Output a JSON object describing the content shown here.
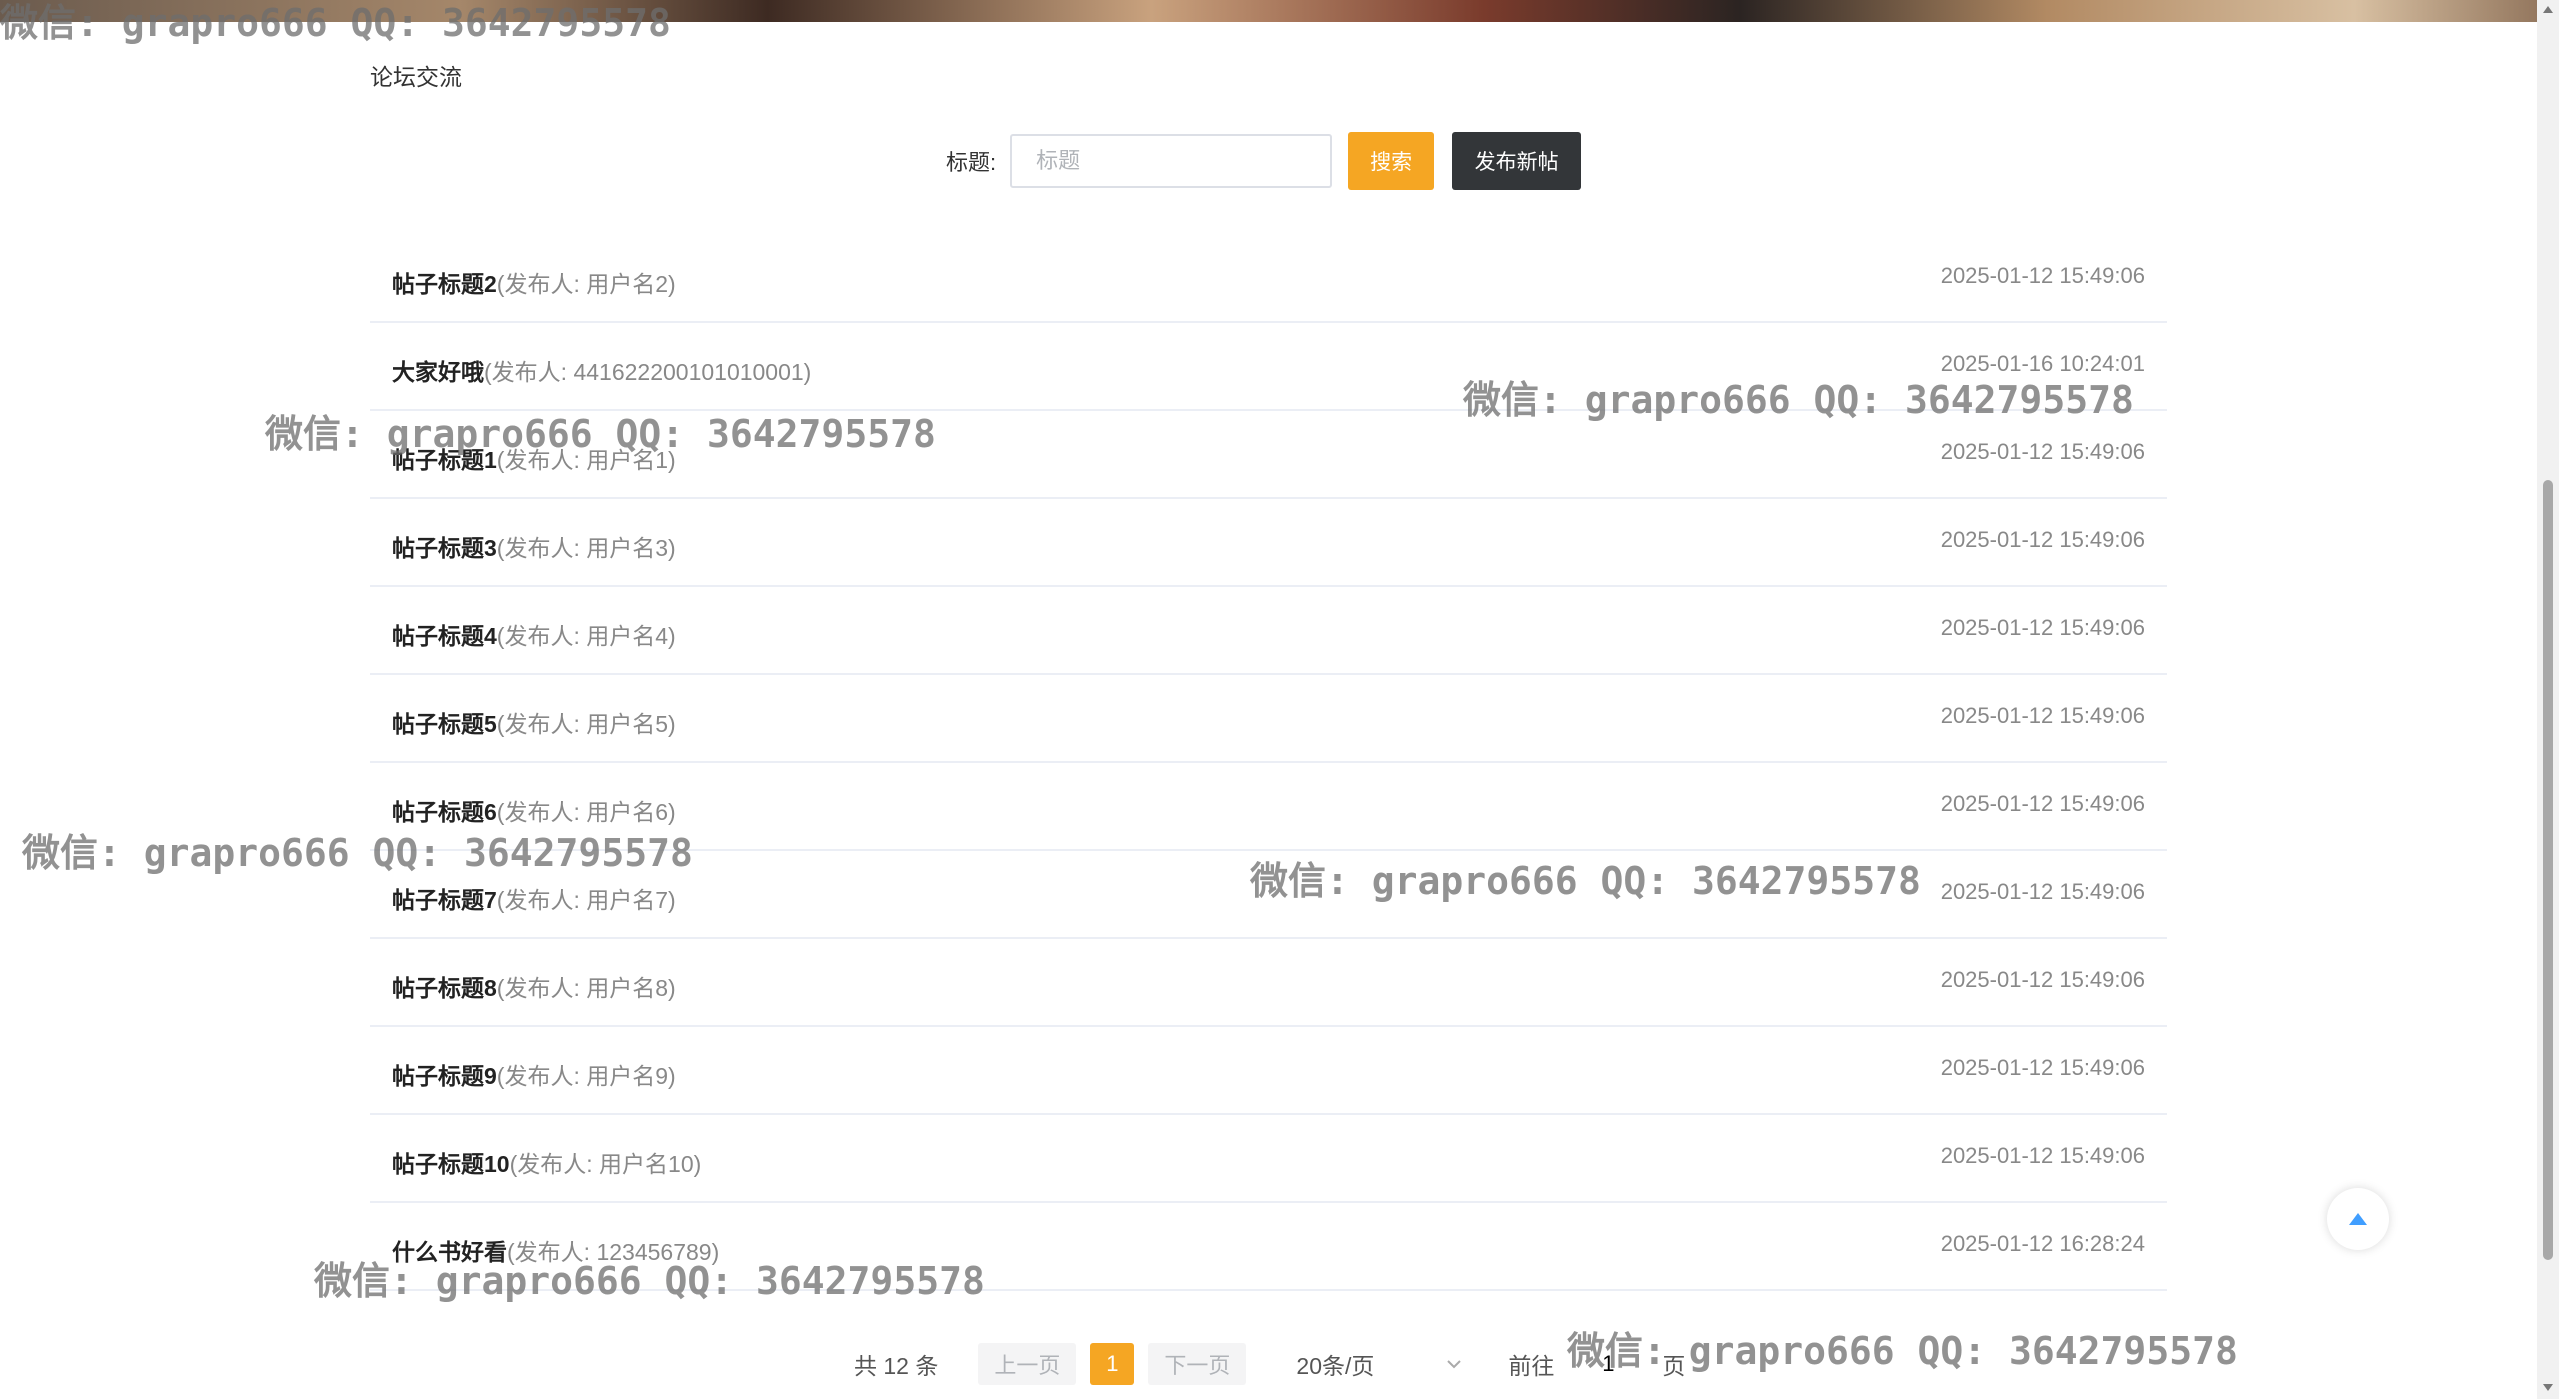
{
  "breadcrumb": "论坛交流",
  "search": {
    "label": "标题:",
    "placeholder": "标题",
    "search_button": "搜索",
    "new_post_button": "发布新帖"
  },
  "posts": [
    {
      "title": "帖子标题2",
      "author": "(发布人: 用户名2)",
      "date": "2025-01-12 15:49:06"
    },
    {
      "title": "大家好哦",
      "author": "(发布人: 441622200101010001)",
      "date": "2025-01-16 10:24:01"
    },
    {
      "title": "帖子标题1",
      "author": "(发布人: 用户名1)",
      "date": "2025-01-12 15:49:06"
    },
    {
      "title": "帖子标题3",
      "author": "(发布人: 用户名3)",
      "date": "2025-01-12 15:49:06"
    },
    {
      "title": "帖子标题4",
      "author": "(发布人: 用户名4)",
      "date": "2025-01-12 15:49:06"
    },
    {
      "title": "帖子标题5",
      "author": "(发布人: 用户名5)",
      "date": "2025-01-12 15:49:06"
    },
    {
      "title": "帖子标题6",
      "author": "(发布人: 用户名6)",
      "date": "2025-01-12 15:49:06"
    },
    {
      "title": "帖子标题7",
      "author": "(发布人: 用户名7)",
      "date": "2025-01-12 15:49:06"
    },
    {
      "title": "帖子标题8",
      "author": "(发布人: 用户名8)",
      "date": "2025-01-12 15:49:06"
    },
    {
      "title": "帖子标题9",
      "author": "(发布人: 用户名9)",
      "date": "2025-01-12 15:49:06"
    },
    {
      "title": "帖子标题10",
      "author": "(发布人: 用户名10)",
      "date": "2025-01-12 15:49:06"
    },
    {
      "title": "什么书好看",
      "author": "(发布人: 123456789)",
      "date": "2025-01-12 16:28:24"
    }
  ],
  "pagination": {
    "total": "共 12 条",
    "prev": "上一页",
    "current": "1",
    "next": "下一页",
    "page_size": "20条/页",
    "goto_prefix": "前往",
    "goto_value": "1",
    "goto_suffix": "页"
  },
  "watermark": "微信: grapro666 QQ: 3642795578",
  "colors": {
    "accent": "#f5a623",
    "dark_button": "#333639",
    "back_top_icon": "#409eff"
  }
}
